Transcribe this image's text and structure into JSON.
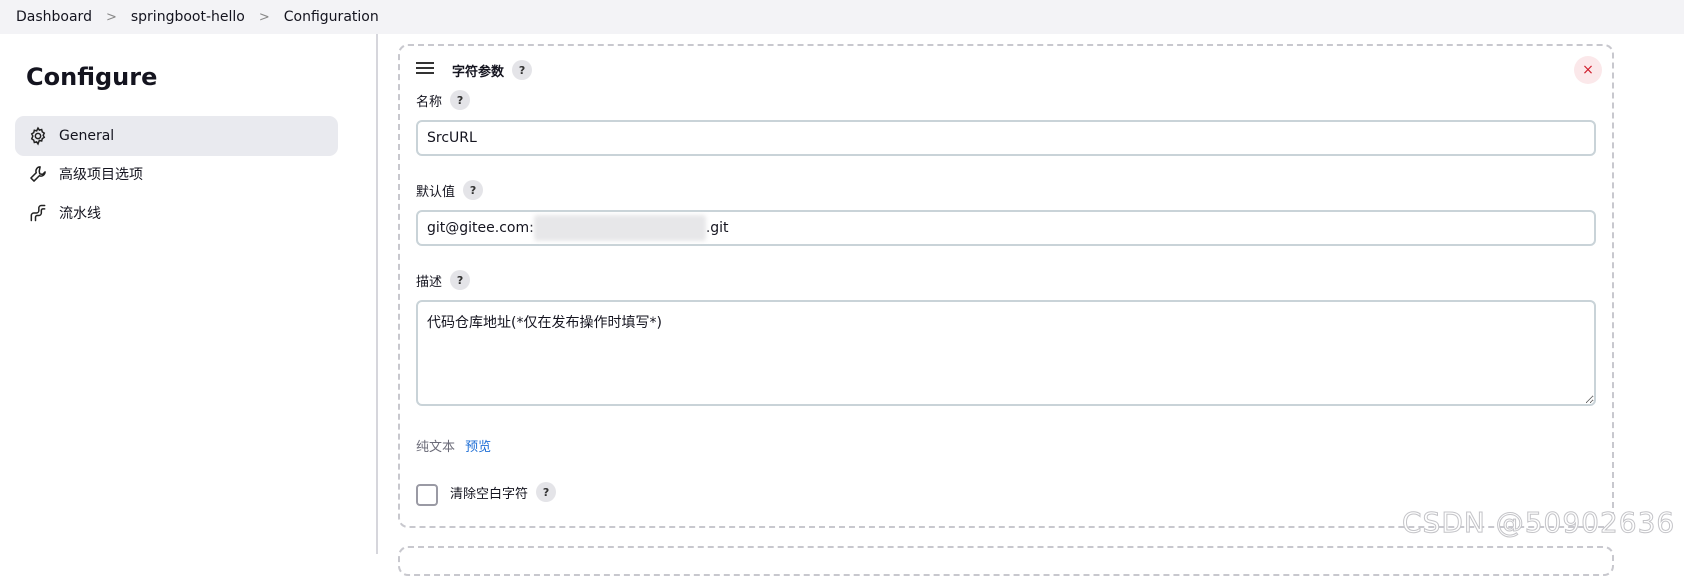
{
  "breadcrumb": {
    "items": [
      "Dashboard",
      "springboot-hello",
      "Configuration"
    ],
    "separator": ">"
  },
  "sidebar": {
    "title": "Configure",
    "items": [
      {
        "label": "General",
        "icon": "gear-icon",
        "active": true
      },
      {
        "label": "高级项目选项",
        "icon": "wrench-icon",
        "active": false
      },
      {
        "label": "流水线",
        "icon": "pipeline-icon",
        "active": false
      }
    ]
  },
  "param": {
    "title": "字符参数",
    "help": "?",
    "close": "×",
    "name_label": "名称",
    "name_value": "SrcURL",
    "default_label": "默认值",
    "default_value_prefix": "git@gitee.com:",
    "default_value_suffix": ".git",
    "desc_label": "描述",
    "desc_value": "代码仓库地址(*仅在发布操作时填写*)",
    "plain_text": "纯文本",
    "preview": "预览",
    "trim_label": "清除空白字符",
    "trim_checked": false
  },
  "watermark": "CSDN @50902636"
}
